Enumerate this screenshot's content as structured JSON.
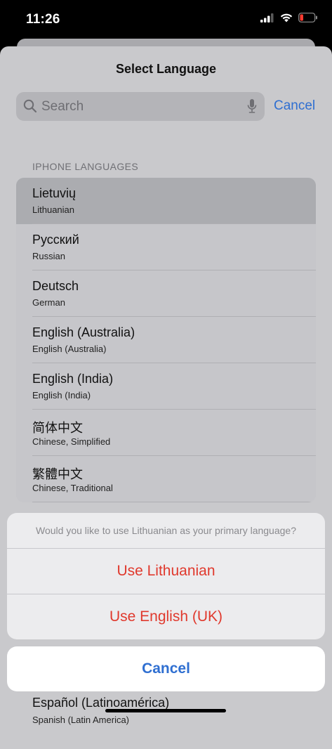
{
  "status_bar": {
    "time": "11:26",
    "icons": [
      "cellular-signal-icon",
      "wifi-icon",
      "battery-low-icon"
    ],
    "battery_color": "#ff3b30"
  },
  "sheet": {
    "title": "Select Language",
    "search": {
      "placeholder": "Search",
      "cancel_label": "Cancel"
    },
    "section_header": "IPHONE LANGUAGES",
    "languages": [
      {
        "native": "Lietuvių",
        "english": "Lithuanian",
        "selected": true
      },
      {
        "native": "Русский",
        "english": "Russian",
        "selected": false
      },
      {
        "native": "Deutsch",
        "english": "German",
        "selected": false
      },
      {
        "native": "English (Australia)",
        "english": "English (Australia)",
        "selected": false
      },
      {
        "native": "English (India)",
        "english": "English (India)",
        "selected": false
      },
      {
        "native": "简体中文",
        "english": "Chinese, Simplified",
        "selected": false
      },
      {
        "native": "繁體中文",
        "english": "Chinese, Traditional",
        "selected": false
      }
    ],
    "partially_visible_language": {
      "native": "Español (Latinoamérica)",
      "english": "Spanish (Latin America)"
    }
  },
  "action_sheet": {
    "message": "Would you like to use Lithuanian as your primary language?",
    "options": [
      "Use Lithuanian",
      "Use English (UK)"
    ],
    "cancel_label": "Cancel",
    "destructive_color": "#e0392d",
    "accent_color": "#2f6fd1"
  }
}
